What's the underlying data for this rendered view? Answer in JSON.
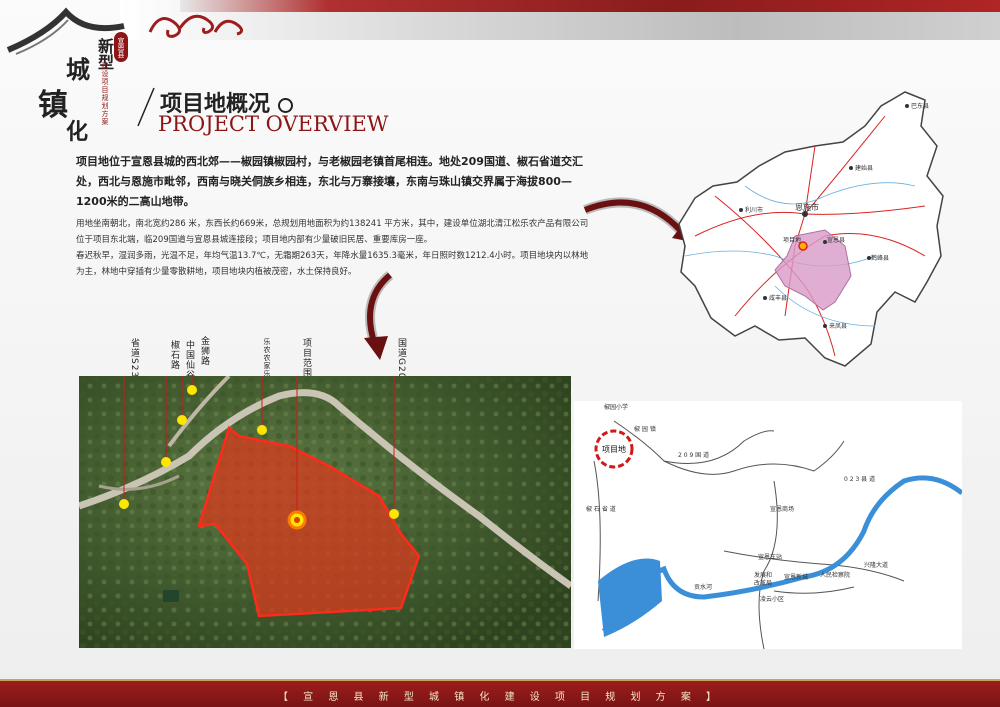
{
  "logo": {
    "county": "宣恩县",
    "line1": "新型",
    "line2": "城",
    "line3": "镇",
    "line4": "化",
    "subtitle": "建设项目规划方案"
  },
  "section": {
    "title_cn": "项目地概况",
    "title_en": "PROJECT OVERVIEW"
  },
  "intro": "项目地位于宣恩县城的西北郊——椒园镇椒园村，与老椒园老镇首尾相连。地处209国道、椒石省道交汇处，西北与恩施市毗邻，西南与晓关侗族乡相连，东北与万寨接壤，东南与珠山镇交界属于海拔800—1200米的二高山地带。",
  "body": [
    "用地坐南朝北，南北宽约286 米，东西长约669米，总规划用地面积为约138241 平方米，其中，建设单位湖北清江松乐农产品有限公司位于项目东北端，临209国道与宣恩县城连接段；项目地内部有少量破旧民居、重要库房一座。",
    "春迟秋早，湿润多雨，光温不足，年均气温13.7℃，无霜期263天，年降水量1635.3毫米，年日照时数1212.4小时。项目地块内以林地为主，林地中穿插有少量零散耕地，项目地块内植被茂密，水土保持良好。"
  ],
  "callouts": [
    {
      "label": "省道S232"
    },
    {
      "label": "椒石路"
    },
    {
      "label": "中国仙谷"
    },
    {
      "label": "金狮路"
    },
    {
      "label": "乐农农家乐"
    },
    {
      "label": "项目范围"
    },
    {
      "label": "国道G209"
    }
  ],
  "region_map": {
    "labels": {
      "badong": "巴东县",
      "jianshi": "建始县",
      "lichuan": "利川市",
      "enshi": "恩施市",
      "xuanen": "宣恩县",
      "site": "项目地",
      "hefeng": "鹤峰县",
      "xianfeng": "咸丰县",
      "laifeng": "来凤县"
    }
  },
  "site_map": {
    "labels": {
      "school": "椒园小学",
      "project": "项目地",
      "road_mid": "2 0 9 国 道",
      "road_upper": "椒 园 镇",
      "station": "宣恩车站",
      "newtown": "宣恩新城",
      "dev": "发展和",
      "dev2": "改革局",
      "museum": "人民检察院",
      "cloud": "凌云小区",
      "bridge": "兴隆大道",
      "river": "贡水河",
      "road_top": "0 2 3 县 道",
      "road_left": "椒 石 省 道",
      "shopping": "宣恩商场"
    }
  },
  "footer": "【 宣 恩 县 新 型 城 镇 化 建 设 项 目 规 划 方 案 】",
  "colors": {
    "brand_red": "#8c1515",
    "site_fill": "#d83a1e",
    "callout": "#ffe600"
  }
}
